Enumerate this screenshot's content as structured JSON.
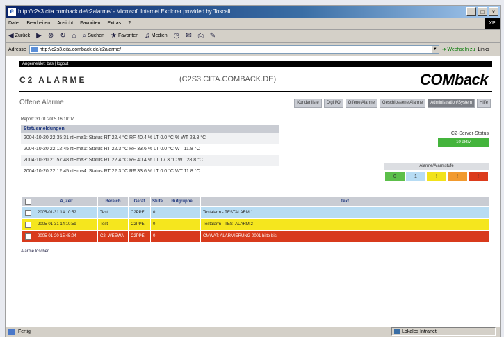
{
  "window": {
    "title": "http://c2s3.cita.comback.de/c2alarme/ - Microsoft Internet Explorer provided by Toscali",
    "min": "_",
    "max": "□",
    "close": "×",
    "logo_text": "XP"
  },
  "menu": [
    "Datei",
    "Bearbeiten",
    "Ansicht",
    "Favoriten",
    "Extras",
    "?"
  ],
  "toolbar": {
    "back": "Zurück",
    "search": "Suchen",
    "favorites": "Favoriten",
    "media": "Medien"
  },
  "address": {
    "label": "Adresse",
    "url": "http://c2s3.cita.comback.de/c2alarme/",
    "go": "Wechseln zu",
    "links": "Links"
  },
  "page": {
    "userbar": "Angemeldet: bas | logout",
    "title": "C2 ALARME",
    "host": "(C2S3.CITA.COMBACK.DE)",
    "brand": "COMback",
    "subtitle": "Offene Alarme",
    "nav": [
      {
        "label": "Kundenliste",
        "active": false
      },
      {
        "label": "Digi I/O",
        "active": false
      },
      {
        "label": "Offene Alarme",
        "active": false
      },
      {
        "label": "Geschlossene Alarme",
        "active": false
      },
      {
        "label": "Administration/System",
        "active": true
      },
      {
        "label": "Hilfe",
        "active": false
      }
    ],
    "report_line": "Report: 31.01.2005 16:10:07",
    "status": {
      "header": "Statusmeldungen",
      "rows": [
        "2004-10-20 22:35:31 rtHma1: Status RT 22.4 °C RF 40.4 % LT 0.0 °C % WT 28.8 °C",
        "2004-10-20 22:12:45 rtHma1: Status RT 22.3 °C RF 33.6 % LT 0.0 °C WT 11.8 °C",
        "2004-10-20 21:57:48 rtHma3: Status RT 22.4 °C RF 40.4 % LT 17.3 °C WT 28.8 °C",
        "2004-10-20 22:12:45 rtHma4: Status RT 22.3 °C RF 33.6 % LT 0.0 °C WT 11.8 °C"
      ]
    },
    "server": {
      "label": "C2-Server-Status",
      "value": "10 aktiv",
      "color": "#44b43c"
    },
    "alarm_classes": {
      "label": "Alarme/Alarmstufe",
      "items": [
        {
          "value": "0",
          "color": "#5cbf4a"
        },
        {
          "value": "1",
          "color": "#b7dcf4"
        },
        {
          "value": "!",
          "color": "#f2e21a"
        },
        {
          "value": "!",
          "color": "#f29a2e"
        },
        {
          "value": "!",
          "color": "#dc3b1c"
        }
      ]
    },
    "table": {
      "headers": [
        "A_Zeit",
        "Bereich",
        "Gerät",
        "Stufe",
        "Rufgruppe",
        "Text"
      ],
      "rows": [
        {
          "cells": [
            "2005-01-31 14:10:52",
            "Test",
            "C2PPE",
            "0",
            "",
            "Testalarm - TESTALARM 1"
          ],
          "bg": "#b8dcf2",
          "color": "#222"
        },
        {
          "cells": [
            "2005-01-31 14:10:59",
            "Test",
            "C2PPE",
            "0",
            "",
            "Testalarm - TESTALARM 2"
          ],
          "bg": "#f5e61e",
          "color": "#222"
        },
        {
          "cells": [
            "2005-01-20 15:45:04",
            "C2_WEEWA",
            "C2PPE",
            "0",
            "",
            "CMWAT: ALARMIERUNG 0001 bitte bis"
          ],
          "bg": "#d83a1c",
          "color": "#fff"
        }
      ]
    },
    "ack": "Alarme löschen"
  },
  "statusbar": {
    "text": "Fertig",
    "zone": "Lokales Intranet"
  }
}
